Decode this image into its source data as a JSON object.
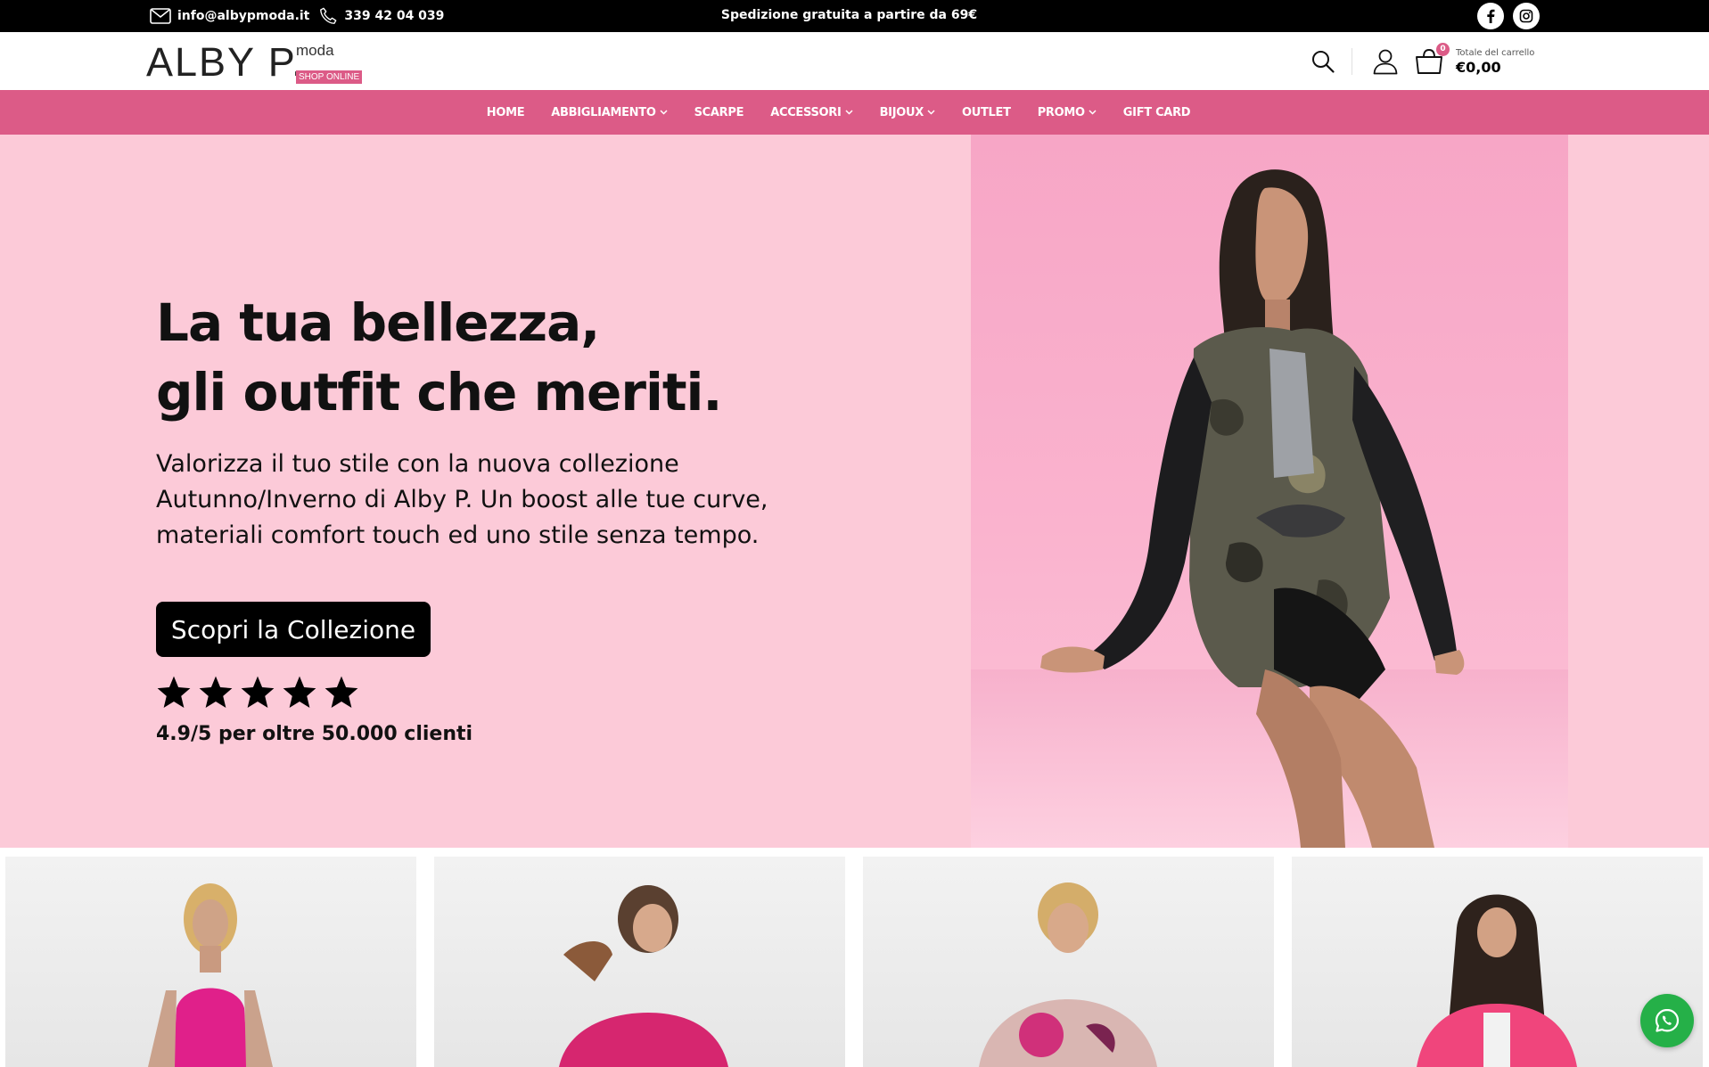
{
  "topbar": {
    "email": "info@albypmoda.it",
    "phone": "339 42 04 039",
    "shipping": "Spedizione gratuita a partire da 69€",
    "social": [
      "facebook-icon",
      "instagram-icon"
    ]
  },
  "header": {
    "logo": {
      "main": "ALBY P.",
      "moda": "moda",
      "shop": "SHOP ONLINE"
    },
    "cart": {
      "count": "0",
      "total_label": "Totale del carrello",
      "total": "€0,00"
    }
  },
  "nav": {
    "items": [
      {
        "label": "HOME",
        "has_dropdown": false
      },
      {
        "label": "ABBIGLIAMENTO",
        "has_dropdown": true
      },
      {
        "label": "SCARPE",
        "has_dropdown": false
      },
      {
        "label": "ACCESSORI",
        "has_dropdown": true
      },
      {
        "label": "BIJOUX",
        "has_dropdown": true
      },
      {
        "label": "OUTLET",
        "has_dropdown": false
      },
      {
        "label": "PROMO",
        "has_dropdown": true
      },
      {
        "label": "GIFT CARD",
        "has_dropdown": false
      }
    ]
  },
  "hero": {
    "title_line1": "La tua bellezza,",
    "title_line2": "gli outfit che meriti.",
    "subtitle": "Valorizza il tuo stile con la nuova collezione Autunno/Inverno di Alby P. Un boost alle tue curve, materiali comfort touch ed uno stile senza tempo.",
    "cta": "Scopri la Collezione",
    "stars": 5,
    "rating_text": "4.9/5 per oltre 50.000 clienti"
  },
  "colors": {
    "brand_pink": "#dc5b87",
    "hero_bg": "#fccad8",
    "topbar_bg": "#000000",
    "whatsapp": "#25b048"
  }
}
